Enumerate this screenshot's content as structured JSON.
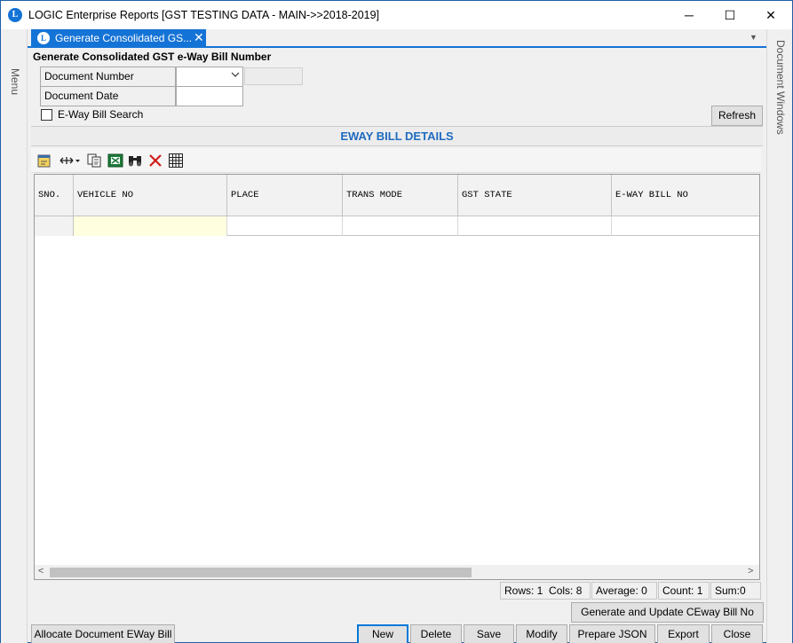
{
  "window": {
    "title": "LOGIC Enterprise Reports  [GST TESTING DATA - MAIN->>2018-2019]",
    "app_icon": "L",
    "min_glyph": "─",
    "max_glyph": "☐",
    "close_glyph": "✕"
  },
  "side": {
    "left_label": "Menu",
    "right_label": "Document Windows"
  },
  "tab": {
    "label": "Generate Consolidated GS...",
    "close": "✕",
    "dropdown": "▼"
  },
  "form": {
    "title": "Generate Consolidated GST e-Way Bill Number",
    "document_number_label": "Document Number",
    "document_number_value": "",
    "document_date_label": "Document Date",
    "document_date_value": "",
    "eway_search_label": "E-Way Bill Search",
    "eway_search_checked": false,
    "refresh_label": "Refresh"
  },
  "section": {
    "title": "EWAY BILL DETAILS"
  },
  "toolbar": {
    "icons": [
      "note-icon",
      "column-resize-icon",
      "copy-icon",
      "excel-export-icon",
      "find-icon",
      "delete-x-icon",
      "grid-icon"
    ]
  },
  "grid": {
    "columns": [
      "SNO.",
      "VEHICLE NO",
      "PLACE",
      "TRANS MODE",
      "GST STATE",
      "E-WAY BILL NO"
    ],
    "rows": [
      [
        "",
        "",
        "",
        "",
        "",
        ""
      ]
    ],
    "scroll_left": "<",
    "scroll_right": ">"
  },
  "status": {
    "rows": "Rows: 1",
    "cols": "Cols: 8",
    "average": "Average: 0",
    "count": "Count: 1",
    "sum": "Sum:0"
  },
  "buttons": {
    "generate_update": "Generate and Update CEway Bill No",
    "allocate": "Allocate Document EWay Bill",
    "new": "New",
    "delete": "Delete",
    "save": "Save",
    "modify": "Modify",
    "prepare_json": "Prepare JSON",
    "export": "Export",
    "close": "Close"
  },
  "colors": {
    "accent": "#1473d6",
    "section_title": "#1f6bc0",
    "highlight_cell": "#ffffe0"
  }
}
